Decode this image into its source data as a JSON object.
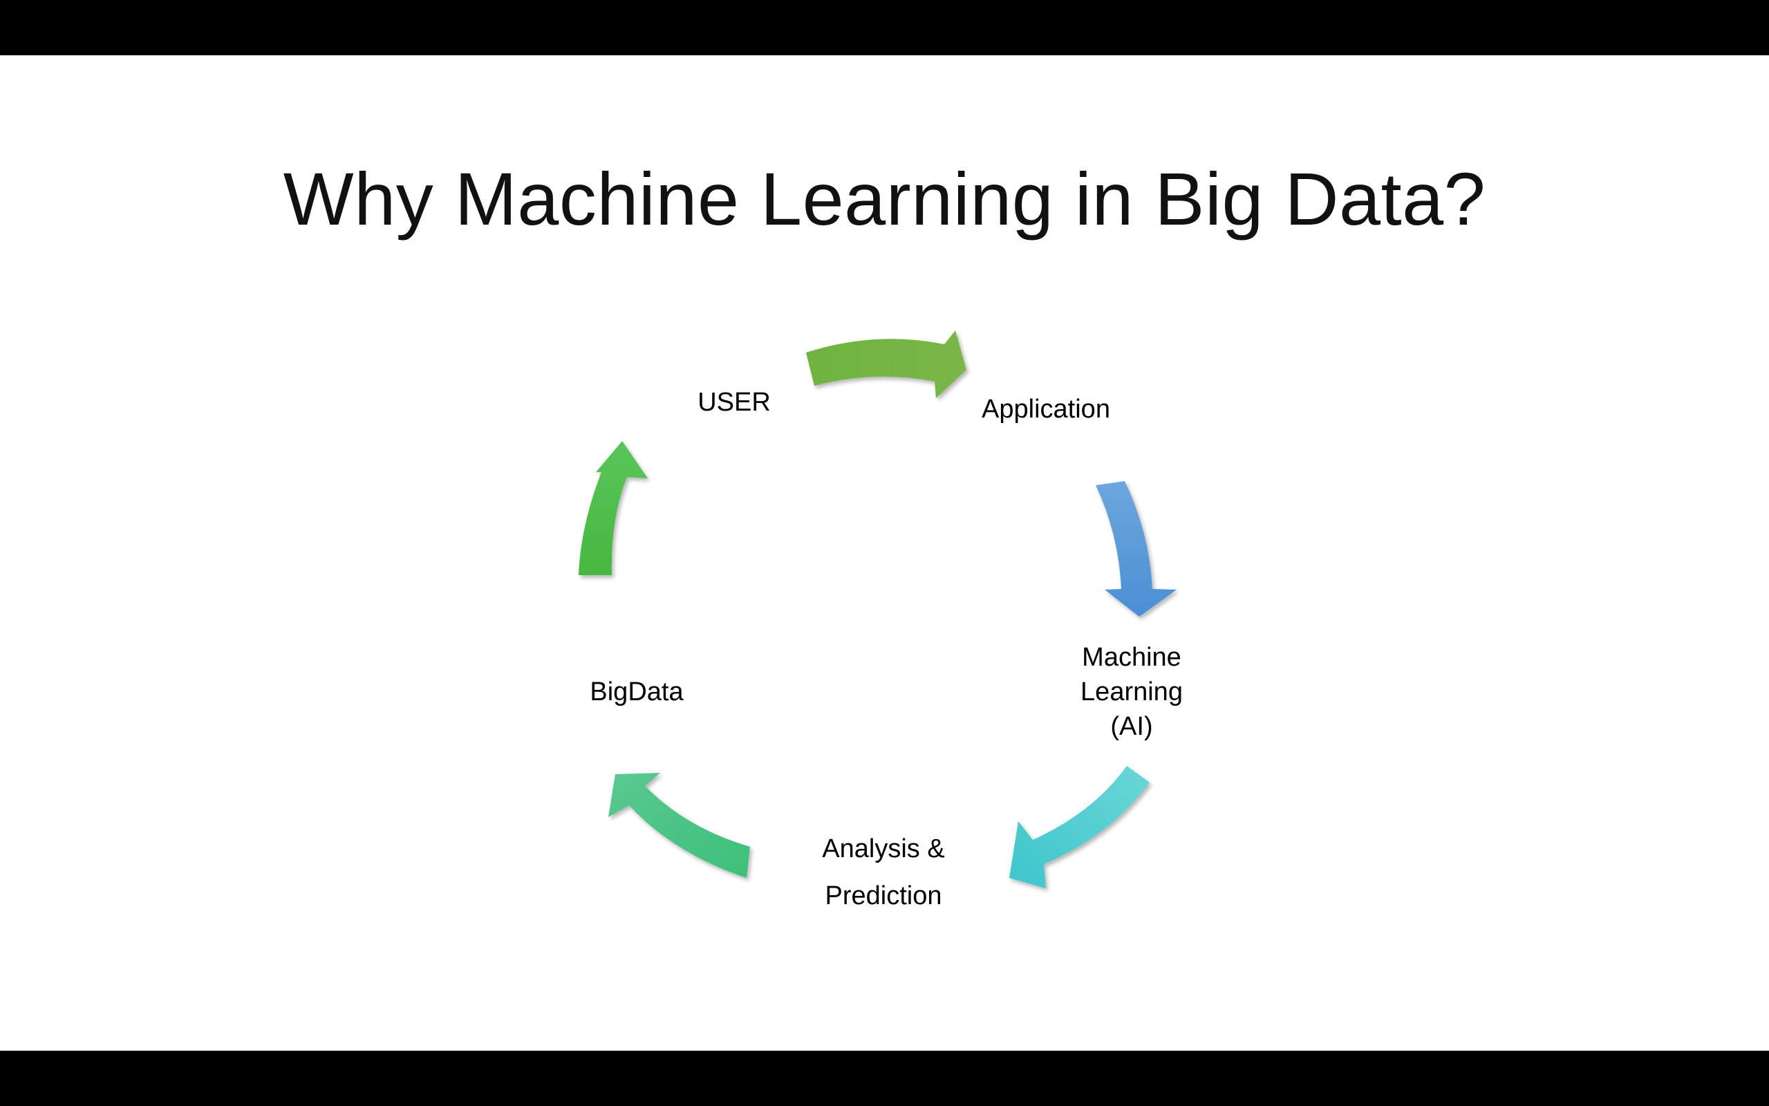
{
  "slide": {
    "title": "Why Machine Learning in Big Data?"
  },
  "cycle": {
    "nodes": [
      {
        "id": "user",
        "label": "USER"
      },
      {
        "id": "application",
        "label": "Application"
      },
      {
        "id": "ml",
        "label_lines": [
          "Machine",
          "Learning",
          "(AI)"
        ]
      },
      {
        "id": "analysis",
        "label_lines": [
          "Analysis &",
          "Prediction"
        ]
      },
      {
        "id": "bigdata",
        "label": "BigData"
      }
    ],
    "arrow_colors": {
      "user_to_application": [
        "#6fb33f",
        "#7ab648"
      ],
      "application_to_ml": [
        "#6ea6de",
        "#4a8fd4"
      ],
      "ml_to_analysis": [
        "#6bd6d6",
        "#3cc6cc"
      ],
      "analysis_to_bigdata": [
        "#5ac890",
        "#3cc07a"
      ],
      "bigdata_to_user": [
        "#45b83f",
        "#5ac55a"
      ]
    }
  }
}
